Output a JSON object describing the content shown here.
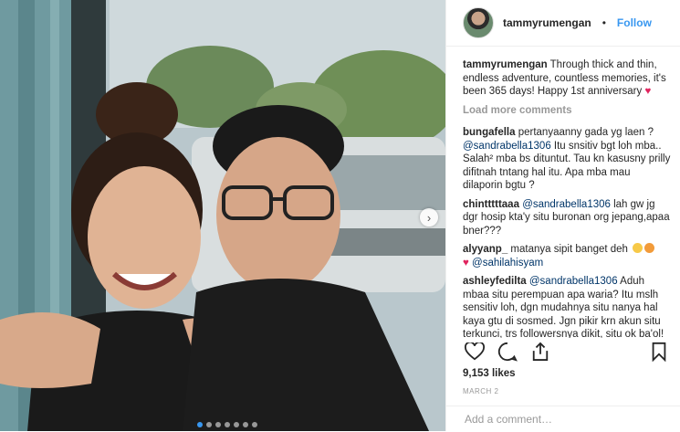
{
  "post": {
    "photo_alt": "",
    "carousel_count": 7,
    "carousel_active": 1
  },
  "header": {
    "username": "tammyrumengan",
    "separator": "•",
    "follow_label": "Follow"
  },
  "caption": {
    "username": "tammyrumengan",
    "text": " Through thick and thin, endless adventure, countless memories, it's been 365 days! Happy 1st anniversary ",
    "heart": "♥"
  },
  "load_more_label": "Load more comments",
  "comments": [
    {
      "username": "bungafella",
      "mention": "@sandrabella1306",
      "text": " Itu snsitiv bgt loh mba.. Salah² mba bs dituntut. Tau kn kasusny prilly difitnah tntang hal itu. Apa mba mau dilaporin bgtu ?",
      "prefix": " pertanyaanny gada yg laen ? "
    },
    {
      "username": "chintttttaaa",
      "mention": "@sandrabella1306",
      "text": " lah gw jg dgr hosip kta'y situ buronan org jepang,apaa bner???"
    },
    {
      "username": "alyyanp_",
      "text": " matanya sipit banget deh",
      "mention": "@sahilahisyam"
    },
    {
      "username": "ashleyfedilta",
      "mention": "@sandrabella1306",
      "text": " Aduh mbaa situ perempuan apa waria? Itu mslh sensitiv loh, dgn mudahnya situ nanya hal kaya gtu di sosmed. Jgn pikir krn akun situ terkunci, trs followersnya dikit, situ ok ba'ol!"
    }
  ],
  "actions": {
    "like": "heart-outline-icon",
    "comment": "speech-bubble-icon",
    "share": "share-icon",
    "save": "bookmark-icon"
  },
  "likes_text": "9,153 likes",
  "date_text": "MARCH 2",
  "comment_box": {
    "placeholder": "Add a comment…"
  },
  "colors": {
    "link_blue": "#3897f0",
    "mention": "#003569",
    "muted": "#999999",
    "text": "#262626"
  }
}
